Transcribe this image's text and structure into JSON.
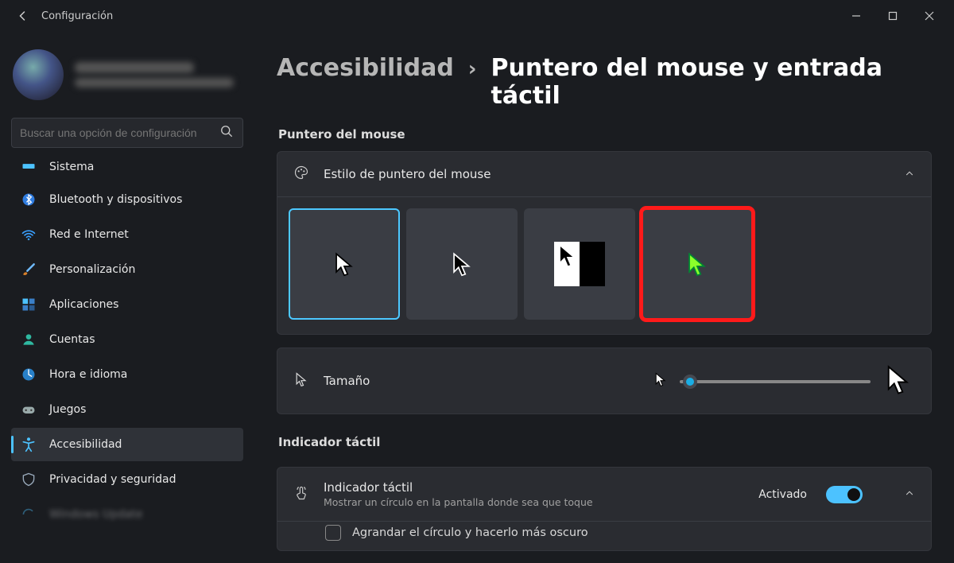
{
  "app": {
    "title": "Configuración"
  },
  "search": {
    "placeholder": "Buscar una opción de configuración"
  },
  "sidebar": {
    "items": [
      {
        "label": "Sistema"
      },
      {
        "label": "Bluetooth y dispositivos"
      },
      {
        "label": "Red e Internet"
      },
      {
        "label": "Personalización"
      },
      {
        "label": "Aplicaciones"
      },
      {
        "label": "Cuentas"
      },
      {
        "label": "Hora e idioma"
      },
      {
        "label": "Juegos"
      },
      {
        "label": "Accesibilidad"
      },
      {
        "label": "Privacidad y seguridad"
      },
      {
        "label": "Windows Update"
      }
    ]
  },
  "breadcrumb": {
    "parent": "Accesibilidad",
    "sep": "›",
    "current": "Puntero del mouse y entrada táctil"
  },
  "sections": {
    "pointer_title": "Puntero del mouse",
    "style_label": "Estilo de puntero del mouse",
    "size_label": "Tamaño",
    "touch_section_title": "Indicador táctil",
    "touch_item_title": "Indicador táctil",
    "touch_item_desc": "Mostrar un círculo en la pantalla donde sea que toque",
    "touch_state": "Activado",
    "touch_sub": "Agrandar el círculo y hacerlo más oscuro"
  },
  "colors": {
    "accent": "#4cc2ff",
    "custom_cursor": "#8cff2a",
    "annotation": "#ff1a1a"
  }
}
